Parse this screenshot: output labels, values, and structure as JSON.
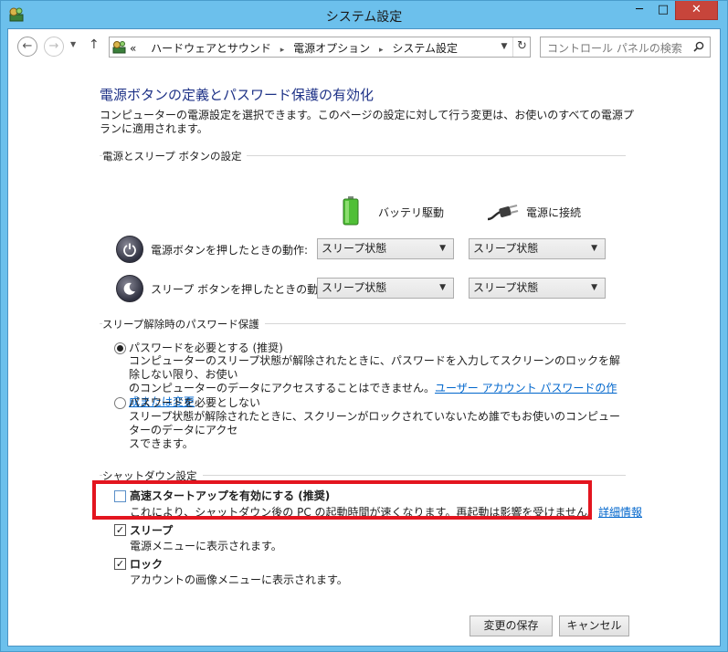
{
  "window": {
    "title": "システム設定",
    "controls": {
      "minimize": "─",
      "maximize": "□",
      "close": "✕"
    }
  },
  "nav": {
    "back_icon": "arrow-left-icon",
    "forward_icon": "arrow-right-icon",
    "recent_icon": "chevron-down-icon",
    "up_icon": "arrow-up-icon",
    "breadcrumb": {
      "overflow": "«",
      "items": [
        "ハードウェアとサウンド",
        "電源オプション",
        "システム設定"
      ],
      "separator": "▸"
    },
    "refresh_icon": "refresh-icon",
    "search_placeholder": "コントロール パネルの検索"
  },
  "page": {
    "title": "電源ボタンの定義とパスワード保護の有効化",
    "description": "コンピューターの電源設定を選択できます。このページの設定に対して行う変更は、お使いのすべての電源プランに適用されます。"
  },
  "power_section": {
    "heading": "電源とスリープ ボタンの設定",
    "columns": {
      "battery": "バッテリ駆動",
      "plugged": "電源に接続"
    },
    "rows": [
      {
        "label": "電源ボタンを押したときの動作:",
        "battery_value": "スリープ状態",
        "plugged_value": "スリープ状態",
        "icon": "power-button-icon"
      },
      {
        "label": "スリープ ボタンを押したときの動作:",
        "battery_value": "スリープ状態",
        "plugged_value": "スリープ状態",
        "icon": "sleep-button-icon"
      }
    ]
  },
  "password_section": {
    "heading": "スリープ解除時のパスワード保護",
    "options": [
      {
        "title": "パスワードを必要とする (推奨)",
        "desc_lines": [
          "コンピューターのスリープ状態が解除されたときに、パスワードを入力してスクリーンのロックを解除しない限り、お使い",
          "のコンピューターのデータにアクセスすることはできません。"
        ],
        "link": "ユーザー アカウント パスワードの作成または変更",
        "selected": true
      },
      {
        "title": "パスワードを必要としない",
        "desc_lines": [
          "スリープ状態が解除されたときに、スクリーンがロックされていないため誰でもお使いのコンピューターのデータにアクセ",
          "スできます。"
        ],
        "selected": false
      }
    ]
  },
  "shutdown_section": {
    "heading": "シャットダウン設定",
    "items": [
      {
        "title": "高速スタートアップを有効にする (推奨)",
        "desc": "これにより、シャットダウン後の PC の起動時間が速くなります。再起動は影響を受けません。",
        "link": "詳細情報",
        "checked": false
      },
      {
        "title": "スリープ",
        "desc": "電源メニューに表示されます。",
        "checked": true
      },
      {
        "title": "ロック",
        "desc": "アカウントの画像メニューに表示されます。",
        "checked": true
      }
    ],
    "check_mark": "✓"
  },
  "footer": {
    "save_label": "変更の保存",
    "cancel_label": "キャンセル"
  },
  "colors": {
    "window_frame": "#6cc0ec",
    "title_link": "#1e3287",
    "link": "#0066cc",
    "close_button": "#c7453b",
    "highlight": "#e3151f"
  }
}
